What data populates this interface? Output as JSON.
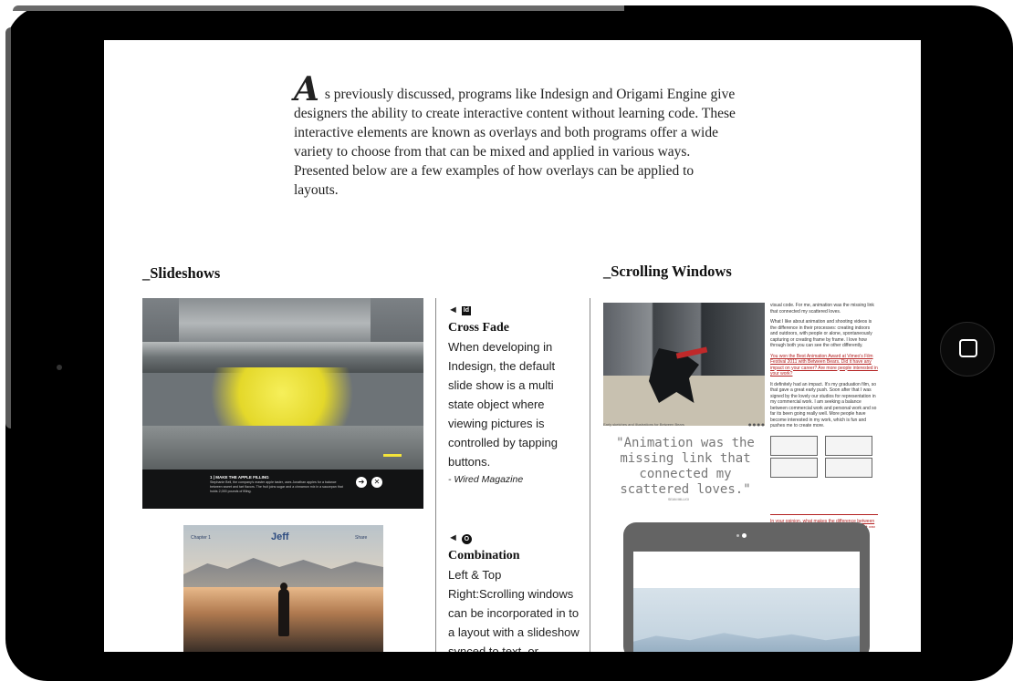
{
  "intro": {
    "dropcap": "A",
    "text": "s previously discussed, programs like Indesign and Origami Engine give designers the ability to create interactive content without learning code. These interactive elements are known as overlays and both programs offer a wide variety to choose from that can be mixed and applied in various ways. Presented below are a few examples of how overlays can be applied to layouts."
  },
  "sections": {
    "slideshows_title": "_Slideshows",
    "scrolling_title": "_Scrolling Windows"
  },
  "slide1": {
    "caption_title": "1 | MAKE THE APPLE FILLING",
    "caption_text": "Stephanie Bell, the company's master apple taster, uses Jonathan apples for a balance between sweet and tart flavors. The fruit joins sugar and a cinnamon mix in a saucepan that holds 2,000 pounds of filling."
  },
  "slide2": {
    "chapter": "Chapter 1",
    "title": "Jeff",
    "share": "Share"
  },
  "crossfade": {
    "icon_arrow": "◄",
    "icon_badge": "Id",
    "title": "Cross Fade",
    "body": "When developing in Indesign, the default slide show is a multi state object where viewing pictures is controlled by tapping buttons.",
    "source": "- Wired Magazine"
  },
  "combination": {
    "icon_arrow": "◄",
    "icon_badge": "O",
    "title": "Combination",
    "body": "Left & Top Right:Scrolling windows can be incorporated in to a layout with a slideshow synced to text, or separated"
  },
  "scrolling": {
    "image_caption": "Early sketches and illustrations for Between Bears",
    "quote": "\"Animation was the missing link that connected my scattered loves.\"",
    "credit": "SEAN MILLIGI",
    "paragraphs": [
      "visual code. For me, animation was the missing link that connected my scattered loves.",
      "What I like about animation and shooting videos is the difference in their processes: creating indoors and outdoors, with people or alone, spontaneously capturing or creating frame by frame. I love how through both you can see the other differently."
    ],
    "red_question": "You won the Best Animation Award at Vimeo's Film Festival 2011 with Between Bears. Did it have any impact on your career? Are more people interested in your work?",
    "answer": "It definitely had an impact. It's my graduation film, so that gave a great early push. Soon after that I was signed by the lovely our studios for representation in my commercial work. I am seeking a balance between commercial work and personal work and so far its been going really well. More people have become interested in my work, which is fun and pushes me to create more.",
    "red_question2": "In your opinion, what makes the difference between a good and a bad animated film? How important are concepts, the storytelling or animation technique?"
  },
  "colors": {
    "accent_red": "#b42222",
    "bezel": "#000000"
  }
}
